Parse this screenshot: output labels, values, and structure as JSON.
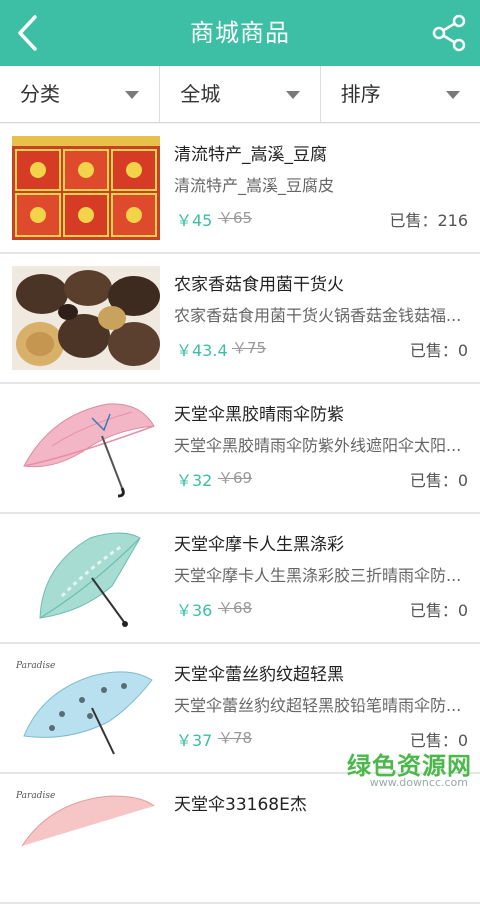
{
  "header": {
    "title": "商城商品",
    "back_icon": "chevron-left-icon",
    "share_icon": "share-icon",
    "bg_color": "#3dbfa5"
  },
  "filters": [
    {
      "label": "分类"
    },
    {
      "label": "全城"
    },
    {
      "label": "排序"
    }
  ],
  "products": [
    {
      "name": "清流特产_嵩溪_豆腐",
      "desc": "清流特产_嵩溪_豆腐皮",
      "price": "￥45",
      "original": "￥65",
      "sold": "已售：216",
      "thumb": "tofu-boxes"
    },
    {
      "name": "农家香菇食用菌干货火",
      "desc": "农家香菇食用菌干货火锅香菇金钱菇福...",
      "price": "￥43.4",
      "original": "￥75",
      "sold": "已售：0",
      "thumb": "dried-mushrooms"
    },
    {
      "name": "天堂伞黑胶晴雨伞防紫",
      "desc": "天堂伞黑胶晴雨伞防紫外线遮阳伞太阳...",
      "price": "￥32",
      "original": "￥69",
      "sold": "已售：0",
      "thumb": "pink-umbrella"
    },
    {
      "name": "天堂伞摩卡人生黑涤彩",
      "desc": "天堂伞摩卡人生黑涤彩胶三折晴雨伞防...",
      "price": "￥36",
      "original": "￥68",
      "sold": "已售：0",
      "thumb": "teal-umbrella"
    },
    {
      "name": "天堂伞蕾丝豹纹超轻黑",
      "desc": "天堂伞蕾丝豹纹超轻黑胶铅笔晴雨伞防...",
      "price": "￥37",
      "original": "￥78",
      "sold": "已售：0",
      "thumb": "blue-umbrella"
    },
    {
      "name": "天堂伞33168E杰",
      "desc": "",
      "price": "",
      "original": "",
      "sold": "",
      "thumb": "umbrella"
    }
  ],
  "watermark": {
    "text": "绿色资源网",
    "url": "www.downcc.com"
  }
}
